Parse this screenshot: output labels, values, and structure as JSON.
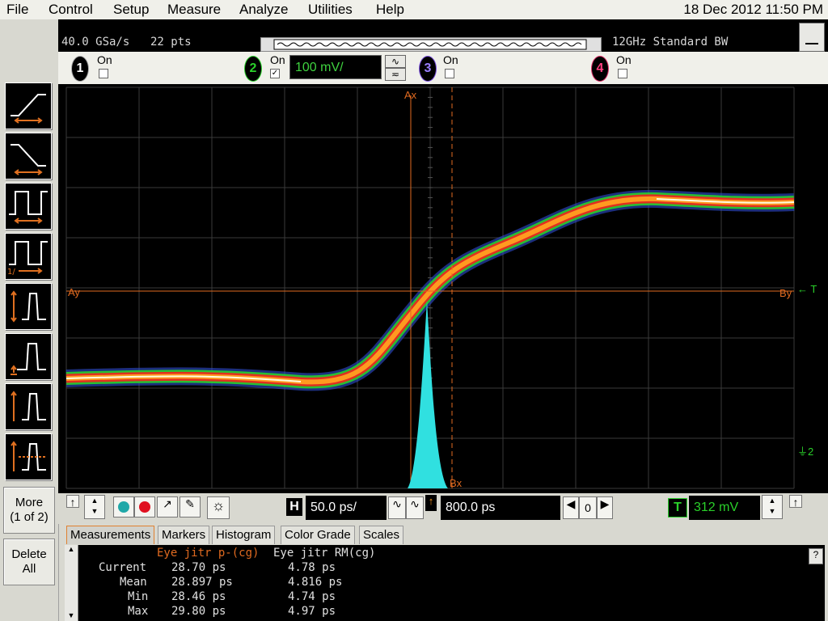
{
  "menu": {
    "items": [
      "File",
      "Control",
      "Setup",
      "Measure",
      "Analyze",
      "Utilities",
      "Help"
    ],
    "datetime": "18 Dec 2012 11:50 PM"
  },
  "status": {
    "sample_rate": "40.0 GSa/s",
    "points": "22 pts",
    "bandwidth": "12GHz Standard BW",
    "minimize_label": "—"
  },
  "channels": [
    {
      "number": "1",
      "label": "On",
      "checked": false,
      "color": "#ffffff"
    },
    {
      "number": "2",
      "label": "On",
      "checked": true,
      "color": "#2ad02a",
      "scale": "100 mV/"
    },
    {
      "number": "3",
      "label": "On",
      "checked": false,
      "color": "#7a4fe0"
    },
    {
      "number": "4",
      "label": "On",
      "checked": false,
      "color": "#e0306a"
    }
  ],
  "markers": {
    "ax": "Ax",
    "ay": "Ay",
    "bx": "Bx",
    "by": "By",
    "trigger": "T",
    "ground": "2"
  },
  "sidebar": {
    "more_label": "More",
    "more_page": "(1 of 2)",
    "delete_label": "Delete",
    "delete_label2": "All",
    "icon_names": [
      "rise-time-icon",
      "fall-time-icon",
      "period-icon",
      "frequency-icon",
      "vpp-icon",
      "vmax-icon",
      "vmin-icon",
      "vavg-icon"
    ]
  },
  "timebase": {
    "h_label": "H",
    "h_scale": "50.0 ps/",
    "position": "800.0 ps",
    "ref": "0",
    "t_label": "T",
    "trigger_level": "312 mV"
  },
  "tabs": [
    "Measurements",
    "Markers",
    "Histogram",
    "Color Grade",
    "Scales"
  ],
  "measurements": {
    "col1_title": "Eye jitr p-(cg)",
    "col2_title": "Eye jitr RM(cg)",
    "help": "?",
    "rows": [
      {
        "label": "Current",
        "v1": "28.70 ps",
        "v2": "4.78 ps"
      },
      {
        "label": "Mean",
        "v1": "28.897 ps",
        "v2": "4.816 ps"
      },
      {
        "label": "Min",
        "v1": "28.46 ps",
        "v2": "4.74 ps"
      },
      {
        "label": "Max",
        "v1": "29.80 ps",
        "v2": "4.97 ps"
      }
    ]
  },
  "colors": {
    "marker": "#e06a20",
    "histogram": "#30e0e0",
    "channel2": "#2ad02a",
    "grid": "#333333"
  }
}
